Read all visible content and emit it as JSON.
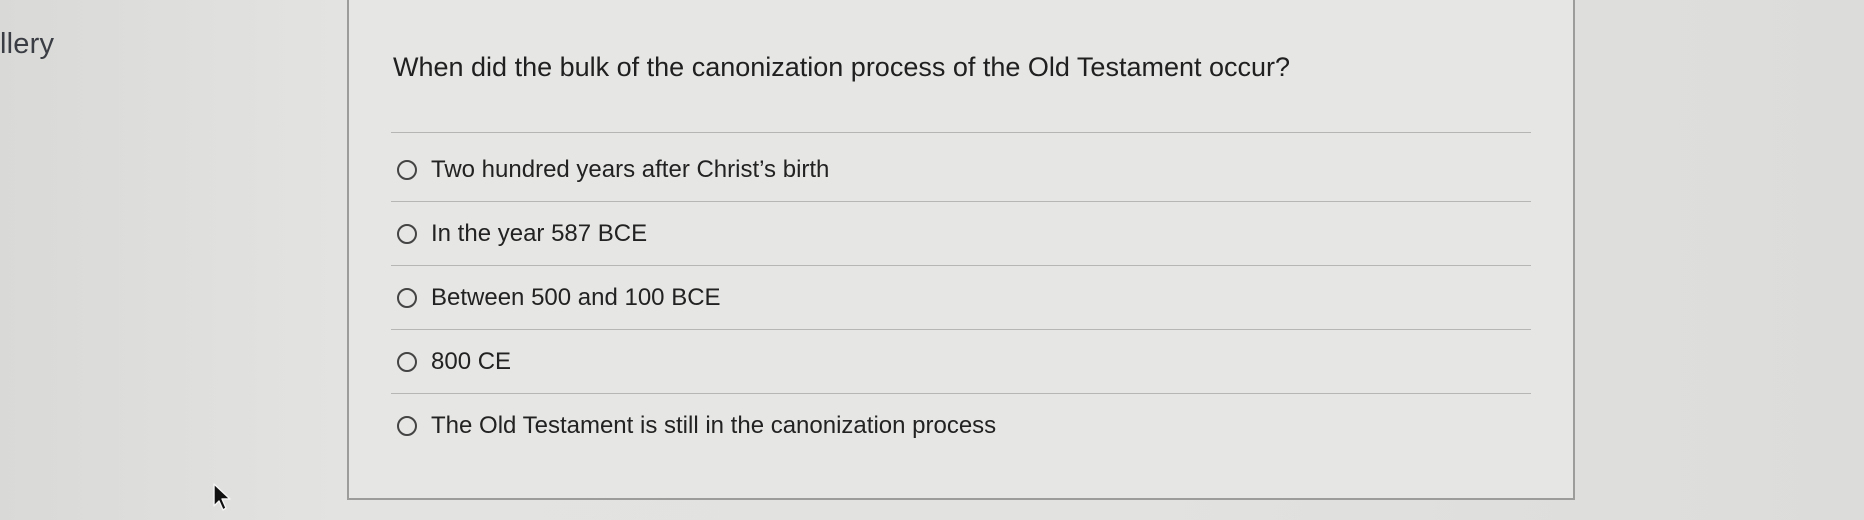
{
  "sidebar": {
    "label": "llery"
  },
  "question": {
    "text": "When did the bulk of the canonization process of the Old Testament occur?",
    "options": [
      {
        "label": "Two hundred years after Christ’s birth",
        "selected": false
      },
      {
        "label": "In the year 587 BCE",
        "selected": false
      },
      {
        "label": "Between 500 and 100 BCE",
        "selected": false
      },
      {
        "label": "800 CE",
        "selected": false
      },
      {
        "label": "The Old Testament is still in the canonization process",
        "selected": false
      }
    ]
  },
  "icons": {
    "pointer": "mouse-pointer-icon"
  },
  "colors": {
    "background": "#e2e2e0",
    "card": "#e6e6e4",
    "text": "#202020",
    "border": "#9c9c9a"
  }
}
